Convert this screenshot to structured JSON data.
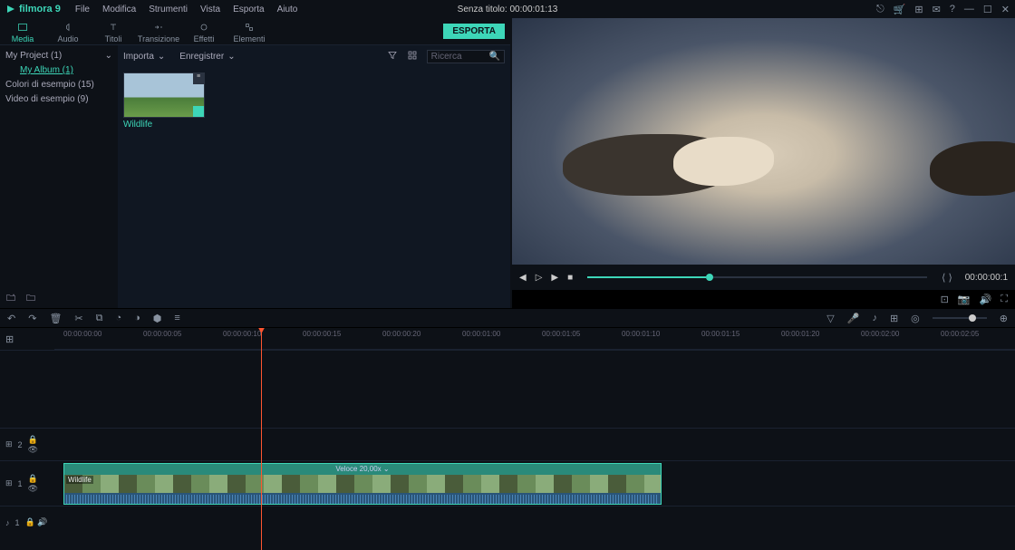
{
  "app": {
    "name": "filmora 9"
  },
  "menu": {
    "file": "File",
    "edit": "Modifica",
    "tools": "Strumenti",
    "view": "Vista",
    "export": "Esporta",
    "help": "Aiuto"
  },
  "document": {
    "title": "Senza titolo:  00:00:01:13"
  },
  "tabs": {
    "media": "Media",
    "audio": "Audio",
    "titles": "Titoli",
    "transition": "Transizione",
    "effects": "Effetti",
    "elements": "Elementi"
  },
  "export_btn": "ESPORTA",
  "tree": {
    "project": "My Project (1)",
    "album": "My Album (1)",
    "colors": "Colori di esempio (15)",
    "videos": "Video di esempio (9)"
  },
  "mediabar": {
    "import": "Importa",
    "record": "Enregistrer",
    "search": "Ricerca"
  },
  "clip": {
    "name": "Wildlife",
    "speed": "Veloce 20,00x"
  },
  "preview": {
    "timecode": "00:00:00:1"
  },
  "ruler": [
    "00:00:00:00",
    "00:00:00:05",
    "00:00:00:10",
    "00:00:00:15",
    "00:00:00:20",
    "00:00:01:00",
    "00:00:01:05",
    "00:00:01:10",
    "00:00:01:15",
    "00:00:01:20",
    "00:00:02:00",
    "00:00:02:05"
  ],
  "tracks": {
    "v2": "2",
    "v1": "1",
    "a1": "1"
  }
}
